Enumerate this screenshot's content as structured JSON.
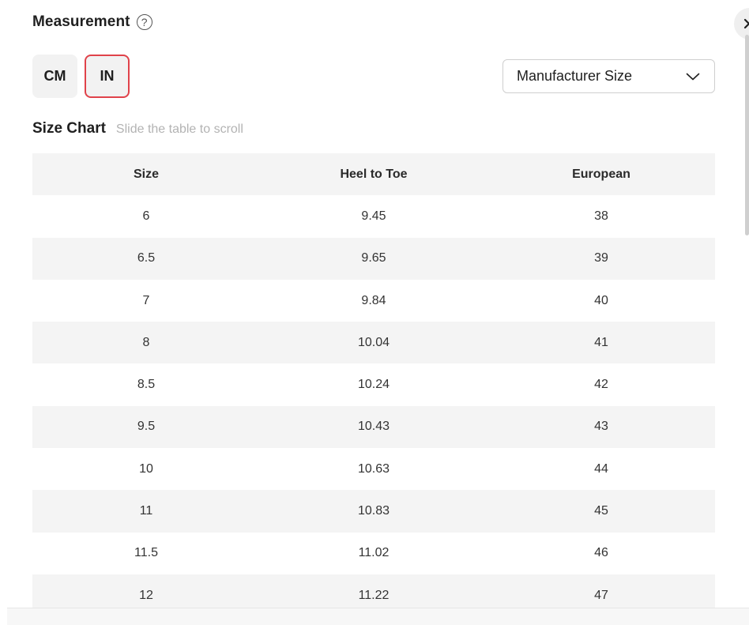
{
  "header": {
    "title": "Measurement",
    "help_icon": "?",
    "close_icon": "✕"
  },
  "units": {
    "cm_label": "CM",
    "in_label": "IN",
    "selected": "IN",
    "selected_color": "#e0424a"
  },
  "size_type": {
    "selected": "Manufacturer Size"
  },
  "chart": {
    "title": "Size Chart",
    "hint": "Slide the table to scroll",
    "columns": [
      "Size",
      "Heel to Toe",
      "European"
    ],
    "rows": [
      [
        "6",
        "9.45",
        "38"
      ],
      [
        "6.5",
        "9.65",
        "39"
      ],
      [
        "7",
        "9.84",
        "40"
      ],
      [
        "8",
        "10.04",
        "41"
      ],
      [
        "8.5",
        "10.24",
        "42"
      ],
      [
        "9.5",
        "10.43",
        "43"
      ],
      [
        "10",
        "10.63",
        "44"
      ],
      [
        "11",
        "10.83",
        "45"
      ],
      [
        "11.5",
        "11.02",
        "46"
      ],
      [
        "12",
        "11.22",
        "47"
      ]
    ]
  }
}
